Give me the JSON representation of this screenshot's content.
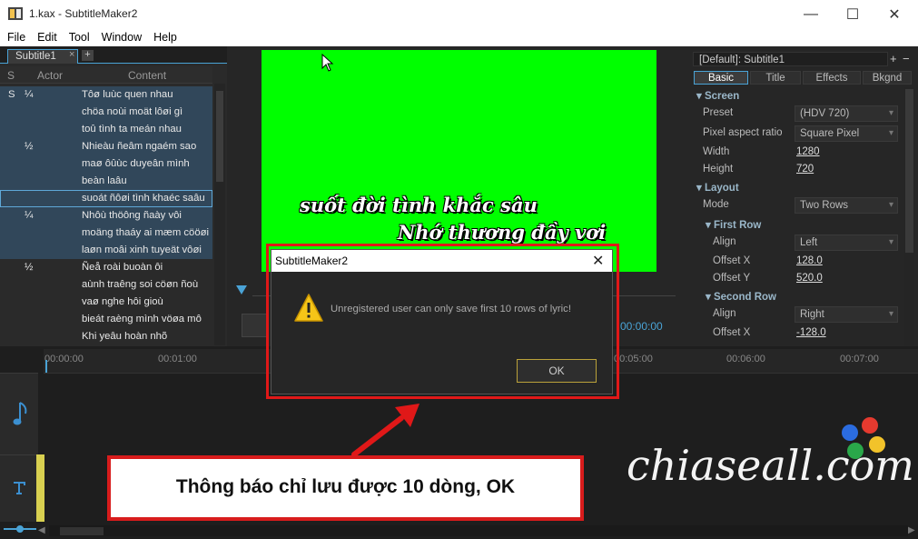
{
  "window": {
    "title": "1.kax - SubtitleMaker2"
  },
  "menu": [
    "File",
    "Edit",
    "Tool",
    "Window",
    "Help"
  ],
  "left": {
    "tab": "Subtitle1",
    "tab_close": "×",
    "tab_add": "+",
    "col_s": "S",
    "col_actor": "Actor",
    "col_content": "Content",
    "rows": [
      {
        "s": "S",
        "a": "¼",
        "c": "Tôø luùc quen nhau"
      },
      {
        "s": "",
        "a": "",
        "c": "chöa noùi moät lôøi gì"
      },
      {
        "s": "",
        "a": "",
        "c": "toû tình ta meán nhau"
      },
      {
        "s": "",
        "a": "½",
        "c": "Nhieàu ñeâm ngaém sao"
      },
      {
        "s": "",
        "a": "",
        "c": "maø ôûùc duyeân mình"
      },
      {
        "s": "",
        "a": "",
        "c": "beàn laâu"
      },
      {
        "s": "",
        "a": "",
        "c": "suoát ñôøi tình khaéc saâu"
      },
      {
        "s": "",
        "a": "¼",
        "c": "Nhôù thöông ñaày vôi"
      },
      {
        "s": "",
        "a": "",
        "c": "moäng thaáy ai mæm cööøi"
      },
      {
        "s": "",
        "a": "",
        "c": "laøn moâi xinh tuyeät vôøi"
      },
      {
        "s": "",
        "a": "½",
        "c": "Ñeå roài buoàn ôi"
      },
      {
        "s": "",
        "a": "",
        "c": "aùnh traêng soi cöøn ñoù"
      },
      {
        "s": "",
        "a": "",
        "c": "vaø nghe hôi gioù"
      },
      {
        "s": "",
        "a": "",
        "c": "bieát raèng mình vöøa mô"
      },
      {
        "s": "",
        "a": "",
        "c": "Khi yeâu hoàn nhõ"
      }
    ]
  },
  "video": {
    "line1": "suốt đời tình khắc sâu",
    "line2": "Nhớ thương đầy vơi",
    "time": "00:00:00"
  },
  "right": {
    "preset": "[Default]: Subtitle1",
    "plus": "+",
    "minus": "−",
    "tabs": [
      "Basic",
      "Title",
      "Effects",
      "Bkgnd"
    ],
    "screen": "Screen",
    "preset_label": "Preset",
    "preset_value": "(HDV 720)",
    "par_label": "Pixel aspect ratio",
    "par_value": "Square Pixel",
    "width_label": "Width",
    "width_value": "1280",
    "height_label": "Height",
    "height_value": "720",
    "layout": "Layout",
    "mode_label": "Mode",
    "mode_value": "Two Rows",
    "first_row": "First Row",
    "fr_align_label": "Align",
    "fr_align_value": "Left",
    "fr_ox_label": "Offset X",
    "fr_ox_value": "128.0",
    "fr_oy_label": "Offset Y",
    "fr_oy_value": "520.0",
    "second_row": "Second Row",
    "sr_align_label": "Align",
    "sr_align_value": "Right",
    "sr_ox_label": "Offset X",
    "sr_ox_value": "-128.0"
  },
  "timeline": {
    "ticks": [
      "00:00:00",
      "00:01:00",
      "00:05:00",
      "00:06:00",
      "00:07:00"
    ]
  },
  "dialog": {
    "title": "SubtitleMaker2",
    "close": "✕",
    "message": "Unregistered user can only save first 10 rows of lyric!",
    "ok": "OK"
  },
  "callout": {
    "text": "Thông báo chỉ lưu được 10 dòng, OK"
  },
  "watermark": "chiaseall.com"
}
